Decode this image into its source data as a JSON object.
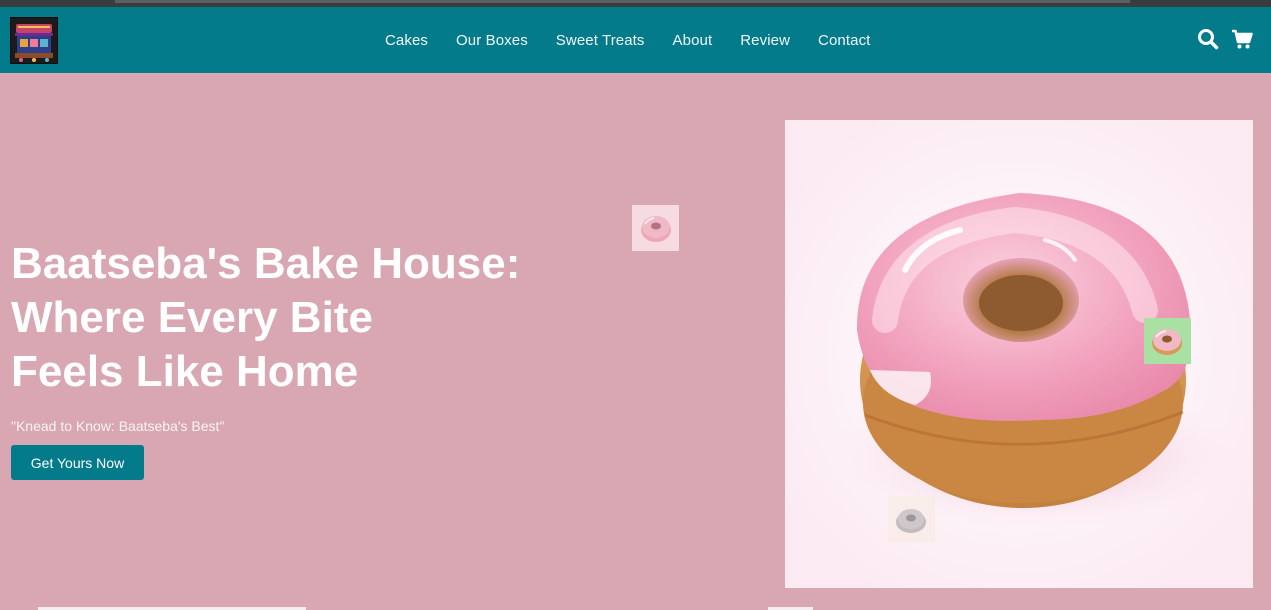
{
  "brand": {
    "logo_icon": "bakery-logo-icon",
    "colors": {
      "nav_bg": "#037b8a",
      "page_bg": "#d8a7b1",
      "accent": "#037b8a",
      "text_light": "#ffffff"
    }
  },
  "nav": {
    "links": [
      {
        "label": "Cakes"
      },
      {
        "label": "Our Boxes"
      },
      {
        "label": "Sweet Treats"
      },
      {
        "label": "About"
      },
      {
        "label": "Review"
      },
      {
        "label": "Contact"
      }
    ],
    "icons": [
      "search-icon",
      "cart-icon"
    ]
  },
  "hero": {
    "title_lines": [
      "Baatseba's Bake House:",
      "Where Every Bite",
      "Feels Like Home"
    ],
    "subtitle": "\"Knead to Know: Baatseba's Best\"",
    "cta_label": "Get Yours Now",
    "image": "pink-glazed-donut-image",
    "floating_thumbnails": [
      "donut-thumbnail",
      "donut-thumbnail",
      "donut-thumbnail"
    ]
  }
}
